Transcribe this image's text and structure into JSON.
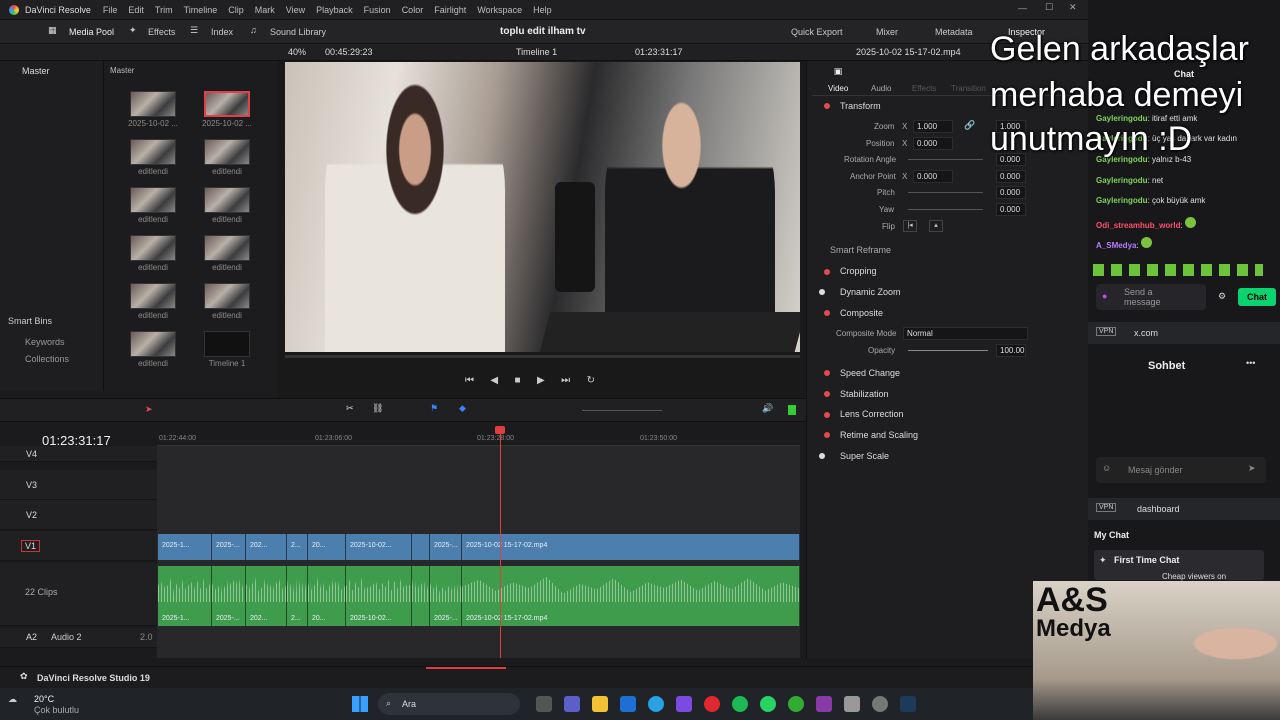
{
  "menubar": {
    "app_name": "DaVinci Resolve",
    "items": [
      "File",
      "Edit",
      "Trim",
      "Timeline",
      "Clip",
      "Mark",
      "View",
      "Playback",
      "Fusion",
      "Color",
      "Fairlight",
      "Workspace",
      "Help"
    ]
  },
  "toolbar": {
    "media_pool": "Media Pool",
    "effects": "Effects",
    "index": "Index",
    "sound_library": "Sound Library",
    "project_title": "toplu edit ilham tv",
    "quick_export": "Quick Export",
    "mixer": "Mixer",
    "metadata": "Metadata",
    "inspector": "Inspector"
  },
  "viewer_bar": {
    "zoom": "40%",
    "duration": "00:45:29:23",
    "timeline_name": "Timeline 1",
    "timecode": "01:23:31:17",
    "clip_name": "2025-10-02 15-17-02.mp4"
  },
  "media_pool": {
    "master_left": "Master",
    "master_right": "Master",
    "smart_bins": "Smart Bins",
    "keywords": "Keywords",
    "collections": "Collections",
    "clips": [
      "2025-10-02 ...",
      "2025-10-02 ...",
      "editlendi",
      "editlendi",
      "editlendi",
      "editlendi",
      "editlendi",
      "editlendi",
      "editlendi",
      "editlendi",
      "editlendi",
      "Timeline 1"
    ]
  },
  "inspector": {
    "tabs": [
      "Video",
      "Audio",
      "Effects",
      "Transition"
    ],
    "transform": "Transform",
    "zoom_label": "Zoom",
    "zoom_x": "1.000",
    "zoom_y": "1.000",
    "position_label": "Position",
    "position_x": "0.000",
    "rotation_label": "Rotation Angle",
    "rotation": "0.000",
    "anchor_label": "Anchor Point",
    "anchor_x": "0.000",
    "anchor_y": "0.000",
    "pitch_label": "Pitch",
    "pitch": "0.000",
    "yaw_label": "Yaw",
    "yaw": "0.000",
    "flip_label": "Flip",
    "smart_reframe": "Smart Reframe",
    "cropping": "Cropping",
    "dynamic_zoom": "Dynamic Zoom",
    "composite": "Composite",
    "composite_mode_label": "Composite Mode",
    "composite_mode": "Normal",
    "opacity_label": "Opacity",
    "opacity": "100.00",
    "speed_change": "Speed Change",
    "stabilization": "Stabilization",
    "lens_correction": "Lens Correction",
    "retime": "Retime and Scaling",
    "super_scale": "Super Scale"
  },
  "timeline": {
    "timecode": "01:23:31:17",
    "ruler": [
      "01:22:44:00",
      "01:23:06:00",
      "01:23:28:00",
      "01:23:50:00"
    ],
    "tracks": {
      "v4": "V4",
      "v3": "V3",
      "v2": "V2",
      "v1": "V1",
      "a1_clips": "22 Clips",
      "a2": "A2",
      "a2_name": "Audio 2",
      "a2_level": "2.0"
    },
    "video_clips": [
      "2025-1...",
      "2025-...",
      "202...",
      "2...",
      "20...",
      "2025-10-02...",
      "2025-...",
      "2025-10-02 15-17-02.mp4"
    ],
    "audio_clips": [
      "2025-1...",
      "2025-...",
      "202...",
      "2...",
      "20...",
      "2025-10-02...",
      "2025-...",
      "2025-10-02 15-17-02.mp4"
    ]
  },
  "status": {
    "app": "DaVinci Resolve Studio 19"
  },
  "taskbar": {
    "temp": "20°C",
    "weather": "Çok bulutlu",
    "search": "Ara"
  },
  "overlay": {
    "line1": "Gelen arkadaşlar",
    "line2": "merhaba demeyi",
    "line3": "unutmayın :D"
  },
  "chat": {
    "header": "Chat",
    "messages": [
      {
        "user": "Gayleringodu",
        "text": "itiraf etti amk"
      },
      {
        "user": "Gayleringodu",
        "text": "üç yaş da fark var kadın"
      },
      {
        "user": "Gayleringodu",
        "text": "yalnız b-43"
      },
      {
        "user": "Gayleringodu",
        "text": "net"
      },
      {
        "user": "Gayleringodu",
        "text": "çok büyük amk"
      },
      {
        "user": "Odi_streamhub_world",
        "text": ""
      },
      {
        "user": "A_SMedya",
        "text": ""
      }
    ],
    "send_placeholder": "Send a message",
    "send_button": "Chat",
    "url1": "x.com",
    "sohbet": "Sohbet",
    "mesaj_placeholder": "Mesaj gönder",
    "url2": "dashboard",
    "my_chat": "My Chat",
    "first_time": "First Time Chat",
    "first_time_msg": "Cheap viewers on"
  },
  "logo": {
    "line1": "A&S",
    "line2": "Medya"
  }
}
